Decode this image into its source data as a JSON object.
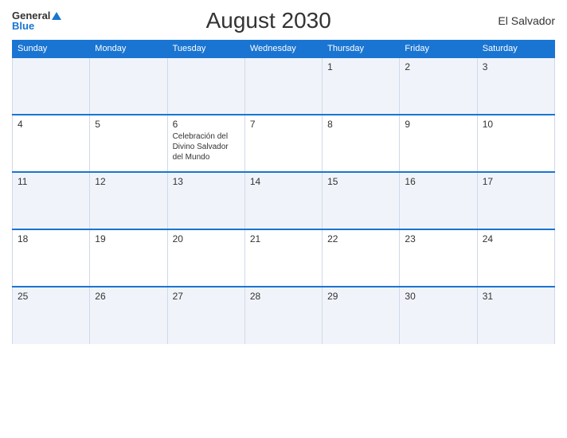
{
  "header": {
    "logo_general": "General",
    "logo_blue": "Blue",
    "title": "August 2030",
    "country": "El Salvador"
  },
  "weekdays": [
    "Sunday",
    "Monday",
    "Tuesday",
    "Wednesday",
    "Thursday",
    "Friday",
    "Saturday"
  ],
  "weeks": [
    [
      {
        "day": "",
        "events": []
      },
      {
        "day": "",
        "events": []
      },
      {
        "day": "",
        "events": []
      },
      {
        "day": "",
        "events": []
      },
      {
        "day": "1",
        "events": []
      },
      {
        "day": "2",
        "events": []
      },
      {
        "day": "3",
        "events": []
      }
    ],
    [
      {
        "day": "4",
        "events": []
      },
      {
        "day": "5",
        "events": []
      },
      {
        "day": "6",
        "events": [
          "Celebración del Divino Salvador del Mundo"
        ]
      },
      {
        "day": "7",
        "events": []
      },
      {
        "day": "8",
        "events": []
      },
      {
        "day": "9",
        "events": []
      },
      {
        "day": "10",
        "events": []
      }
    ],
    [
      {
        "day": "11",
        "events": []
      },
      {
        "day": "12",
        "events": []
      },
      {
        "day": "13",
        "events": []
      },
      {
        "day": "14",
        "events": []
      },
      {
        "day": "15",
        "events": []
      },
      {
        "day": "16",
        "events": []
      },
      {
        "day": "17",
        "events": []
      }
    ],
    [
      {
        "day": "18",
        "events": []
      },
      {
        "day": "19",
        "events": []
      },
      {
        "day": "20",
        "events": []
      },
      {
        "day": "21",
        "events": []
      },
      {
        "day": "22",
        "events": []
      },
      {
        "day": "23",
        "events": []
      },
      {
        "day": "24",
        "events": []
      }
    ],
    [
      {
        "day": "25",
        "events": []
      },
      {
        "day": "26",
        "events": []
      },
      {
        "day": "27",
        "events": []
      },
      {
        "day": "28",
        "events": []
      },
      {
        "day": "29",
        "events": []
      },
      {
        "day": "30",
        "events": []
      },
      {
        "day": "31",
        "events": []
      }
    ]
  ]
}
